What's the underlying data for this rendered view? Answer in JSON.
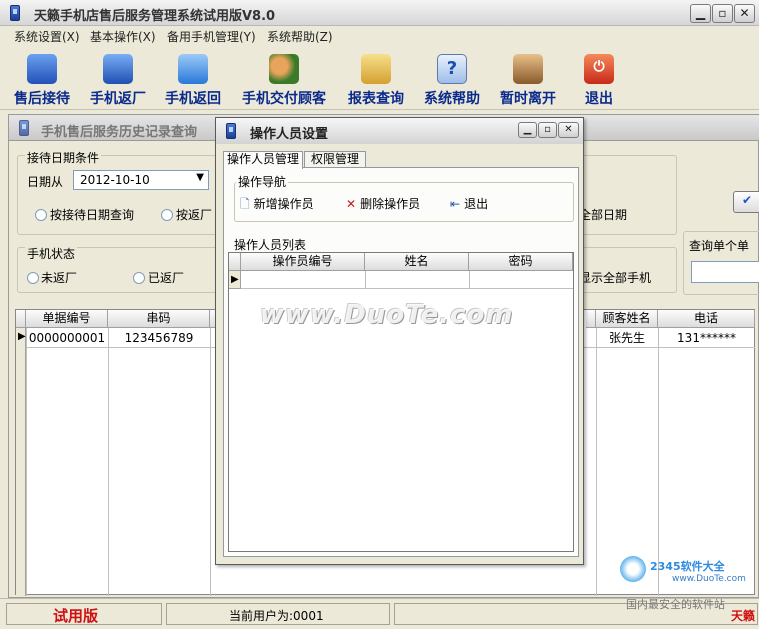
{
  "window": {
    "title": "天籁手机店售后服务管理系统试用版V8.0"
  },
  "menu": [
    "系统设置(X)",
    "基本操作(X)",
    "备用手机管理(Y)",
    "系统帮助(Z)"
  ],
  "toolbar": [
    {
      "label": "售后接待",
      "icon": "phone-reception-icon",
      "color": "#3a6fd6"
    },
    {
      "label": "手机返厂",
      "icon": "phone-return-factory-icon",
      "color": "#2f64c9"
    },
    {
      "label": "手机返回",
      "icon": "phone-return-icon",
      "color": "#2c7be0"
    },
    {
      "label": "手机交付顾客",
      "icon": "deliver-customer-icon",
      "color": "#d97b2a"
    },
    {
      "label": "报表查询",
      "icon": "report-query-icon",
      "color": "#e0b640"
    },
    {
      "label": "系统帮助",
      "icon": "help-icon",
      "color": "#2a6ad0"
    },
    {
      "label": "暂时离开",
      "icon": "leave-icon",
      "color": "#c88a3a"
    },
    {
      "label": "退出",
      "icon": "exit-icon",
      "color": "#d43a1f"
    }
  ],
  "history": {
    "title": "手机售后服务历史记录查询",
    "date_group": "接待日期条件",
    "date_from_label": "日期从",
    "date_from_value": "2012-10-10",
    "radio_reception_date": "按接待日期查询",
    "radio_return_factory": "按返厂",
    "radio_all_dates": "全部日期",
    "phone_status_group": "手机状态",
    "radio_not_returned": "未返厂",
    "radio_returned": "已返厂",
    "radio_show_all_phones": "显示全部手机",
    "single_query_label": "查询单个单",
    "grid": {
      "columns": [
        "单据编号",
        "串码",
        "顾客姓名",
        "电话"
      ],
      "rows": [
        [
          "0000000001",
          "123456789",
          "张先生",
          "131******"
        ]
      ]
    }
  },
  "dialog": {
    "title": "操作人员设置",
    "tabs": [
      "操作人员管理",
      "权限管理"
    ],
    "nav_group": "操作导航",
    "add_button": "新增操作员",
    "delete_button": "删除操作员",
    "exit_button": "退出",
    "list_group": "操作人员列表",
    "list_columns": [
      "操作员编号",
      "姓名",
      "密码"
    ]
  },
  "watermark": "www.DuoTe.com",
  "status": {
    "trial": "试用版",
    "current_user": "当前用户为:0001",
    "right_text": "天籁"
  },
  "corner_logo": {
    "brand": "2345软件大全",
    "url": "www.DuoTe.com",
    "slogan": "国内最安全的软件站"
  }
}
